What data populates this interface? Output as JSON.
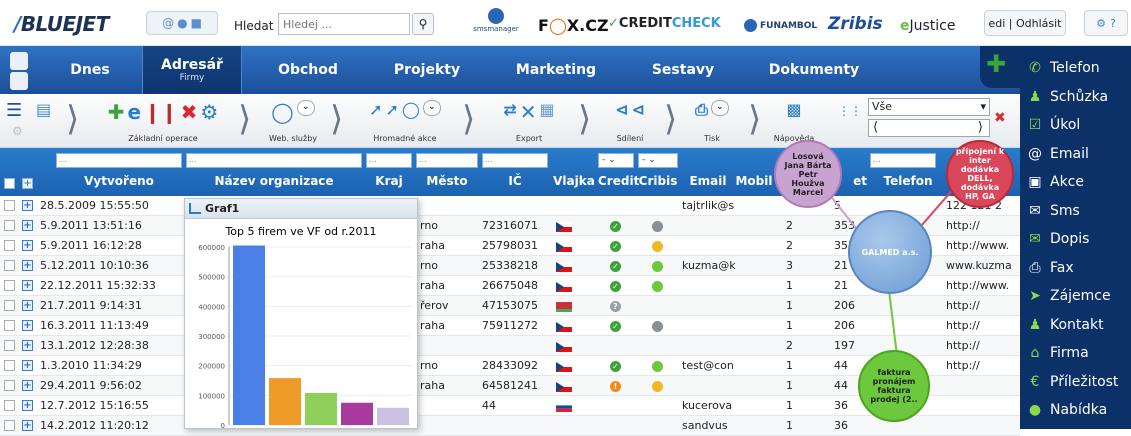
{
  "header": {
    "logo": "BLUEJET",
    "search_label": "Hledat",
    "search_placeholder": "Hledej ...",
    "user_text": "edi | Odhlásit",
    "partners": {
      "sms": "smsmanager",
      "fox": [
        "F",
        "X.CZ"
      ],
      "creditcheck": [
        "CREDIT",
        "CHECK"
      ],
      "funambol": "FUNAMBOL",
      "zribis": "Zribis",
      "ejustice": [
        "e",
        "Justice"
      ]
    }
  },
  "menu": {
    "items": [
      {
        "label": "Dnes",
        "sub": ""
      },
      {
        "label": "Adresář",
        "sub": "Firmy"
      },
      {
        "label": "Obchod",
        "sub": ""
      },
      {
        "label": "Projekty",
        "sub": ""
      },
      {
        "label": "Marketing",
        "sub": ""
      },
      {
        "label": "Sestavy",
        "sub": ""
      },
      {
        "label": "Dokumenty",
        "sub": ""
      }
    ]
  },
  "toolbar": {
    "groups": [
      {
        "label": "Základní operace"
      },
      {
        "label": "Web. služby"
      },
      {
        "label": "Hromadné akce"
      },
      {
        "label": "Export"
      },
      {
        "label": "Sdílení"
      },
      {
        "label": "Tisk"
      },
      {
        "label": "Nápověda"
      }
    ],
    "filter_value": "Vše"
  },
  "grid": {
    "columns": [
      "Vytvořeno",
      "Název organizace",
      "Kraj",
      "Město",
      "IČ",
      "Vlajka",
      "Credit",
      "Cribis",
      "Email",
      "Mobil",
      "et",
      "Telefon"
    ],
    "filter_placeholder": "...",
    "rows": [
      {
        "created": "28.5.2009 15:55:50",
        "city": "",
        "ic": "",
        "flag": "",
        "credit": "",
        "cribis": "",
        "email": "tajtrlik@s",
        "mobil": "",
        "et": "5",
        "tel": "122 121 2"
      },
      {
        "created": "5.9.2011 13:51:16",
        "city": "rno",
        "ic": "72316071",
        "flag": "cz",
        "credit": "ok",
        "cribis": "grey",
        "email": "",
        "mobil": "2",
        "et": "353",
        "tel": "http://"
      },
      {
        "created": "5.9.2011 16:12:28",
        "city": "raha",
        "ic": "25798031",
        "flag": "cz",
        "credit": "ok",
        "cribis": "yellow",
        "email": "",
        "mobil": "2",
        "et": "353",
        "tel": "http://www."
      },
      {
        "created": "5.12.2011 10:10:36",
        "city": "rno",
        "ic": "25338218",
        "flag": "cz",
        "credit": "ok",
        "cribis": "green",
        "email": "kuzma@k",
        "mobil": "3",
        "et": "21",
        "tel": "www.kuzma"
      },
      {
        "created": "22.12.2011 15:32:33",
        "city": "raha",
        "ic": "26675048",
        "flag": "cz",
        "credit": "ok",
        "cribis": "green",
        "email": "",
        "mobil": "1",
        "et": "21",
        "tel": "http://www."
      },
      {
        "created": "21.7.2011 9:14:31",
        "city": "řerov",
        "ic": "47153075",
        "flag": "by",
        "credit": "unknown",
        "cribis": "",
        "email": "",
        "mobil": "1",
        "et": "206",
        "tel": "http://"
      },
      {
        "created": "16.3.2011 11:13:49",
        "city": "raha",
        "ic": "75911272",
        "flag": "cz",
        "credit": "ok",
        "cribis": "grey",
        "email": "",
        "mobil": "1",
        "et": "206",
        "tel": "http://"
      },
      {
        "created": "13.1.2012 12:28:38",
        "city": "",
        "ic": "",
        "flag": "cz",
        "credit": "",
        "cribis": "",
        "email": "",
        "mobil": "2",
        "et": "197",
        "tel": "http://"
      },
      {
        "created": "1.3.2010 11:34:29",
        "city": "rno",
        "ic": "28433092",
        "flag": "cz",
        "credit": "ok",
        "cribis": "green",
        "email": "test@con",
        "mobil": "1",
        "et": "44",
        "tel": "http://"
      },
      {
        "created": "29.4.2011 9:56:02",
        "city": "raha",
        "ic": "64581241",
        "flag": "cz",
        "credit": "warn",
        "cribis": "yellow",
        "email": "",
        "mobil": "1",
        "et": "44",
        "tel": ""
      },
      {
        "created": "12.7.2012 15:16:55",
        "city": "",
        "ic": "44",
        "flag": "sk",
        "credit": "",
        "cribis": "",
        "email": "kucerova",
        "mobil": "1",
        "et": "36",
        "tel": ""
      },
      {
        "created": "14.2.2012 11:20:12",
        "city": "",
        "ic": "",
        "flag": "",
        "credit": "",
        "cribis": "",
        "email": "sandvus",
        "mobil": "1",
        "et": "36",
        "tel": ""
      }
    ]
  },
  "graph_window": {
    "title": "Graf1"
  },
  "chart_data": {
    "type": "bar",
    "title": "Top 5 firem ve VF od r.2011",
    "categories": [
      "",
      "",
      "",
      "",
      ""
    ],
    "values": [
      605000,
      158000,
      108000,
      75000,
      58000
    ],
    "colors": [
      "#4a7fe8",
      "#ee9b2a",
      "#8fd05a",
      "#a83a9c",
      "#c9c0e2"
    ],
    "yticks": [
      "0",
      "100000",
      "200000",
      "300000",
      "400000",
      "500000",
      "600000"
    ],
    "ylim": [
      0,
      600000
    ]
  },
  "mindmap": {
    "center": "GALMED a.s.",
    "nodes": [
      {
        "text": "Losová Jana Bárta Petr Houžva Marcel",
        "color": "#c9a3cf"
      },
      {
        "text": "připojení k inter dodávka DELL, dodávka HP, GA",
        "color": "#d9475a"
      },
      {
        "text": "faktura pronájem faktura prodej (2..",
        "color": "#6cc83c"
      }
    ]
  },
  "right_panel": {
    "items": [
      "Telefon",
      "Schůzka",
      "Úkol",
      "Email",
      "Akce",
      "Sms",
      "Dopis",
      "Fax",
      "Zájemce",
      "Kontakt",
      "Firma",
      "Příležitost",
      "Nabídka"
    ],
    "icons": [
      "phone-icon",
      "meeting-icon",
      "task-icon",
      "email-icon",
      "event-icon",
      "sms-icon",
      "letter-icon",
      "fax-icon",
      "lead-icon",
      "contact-icon",
      "company-icon",
      "opportunity-icon",
      "offer-icon"
    ]
  }
}
